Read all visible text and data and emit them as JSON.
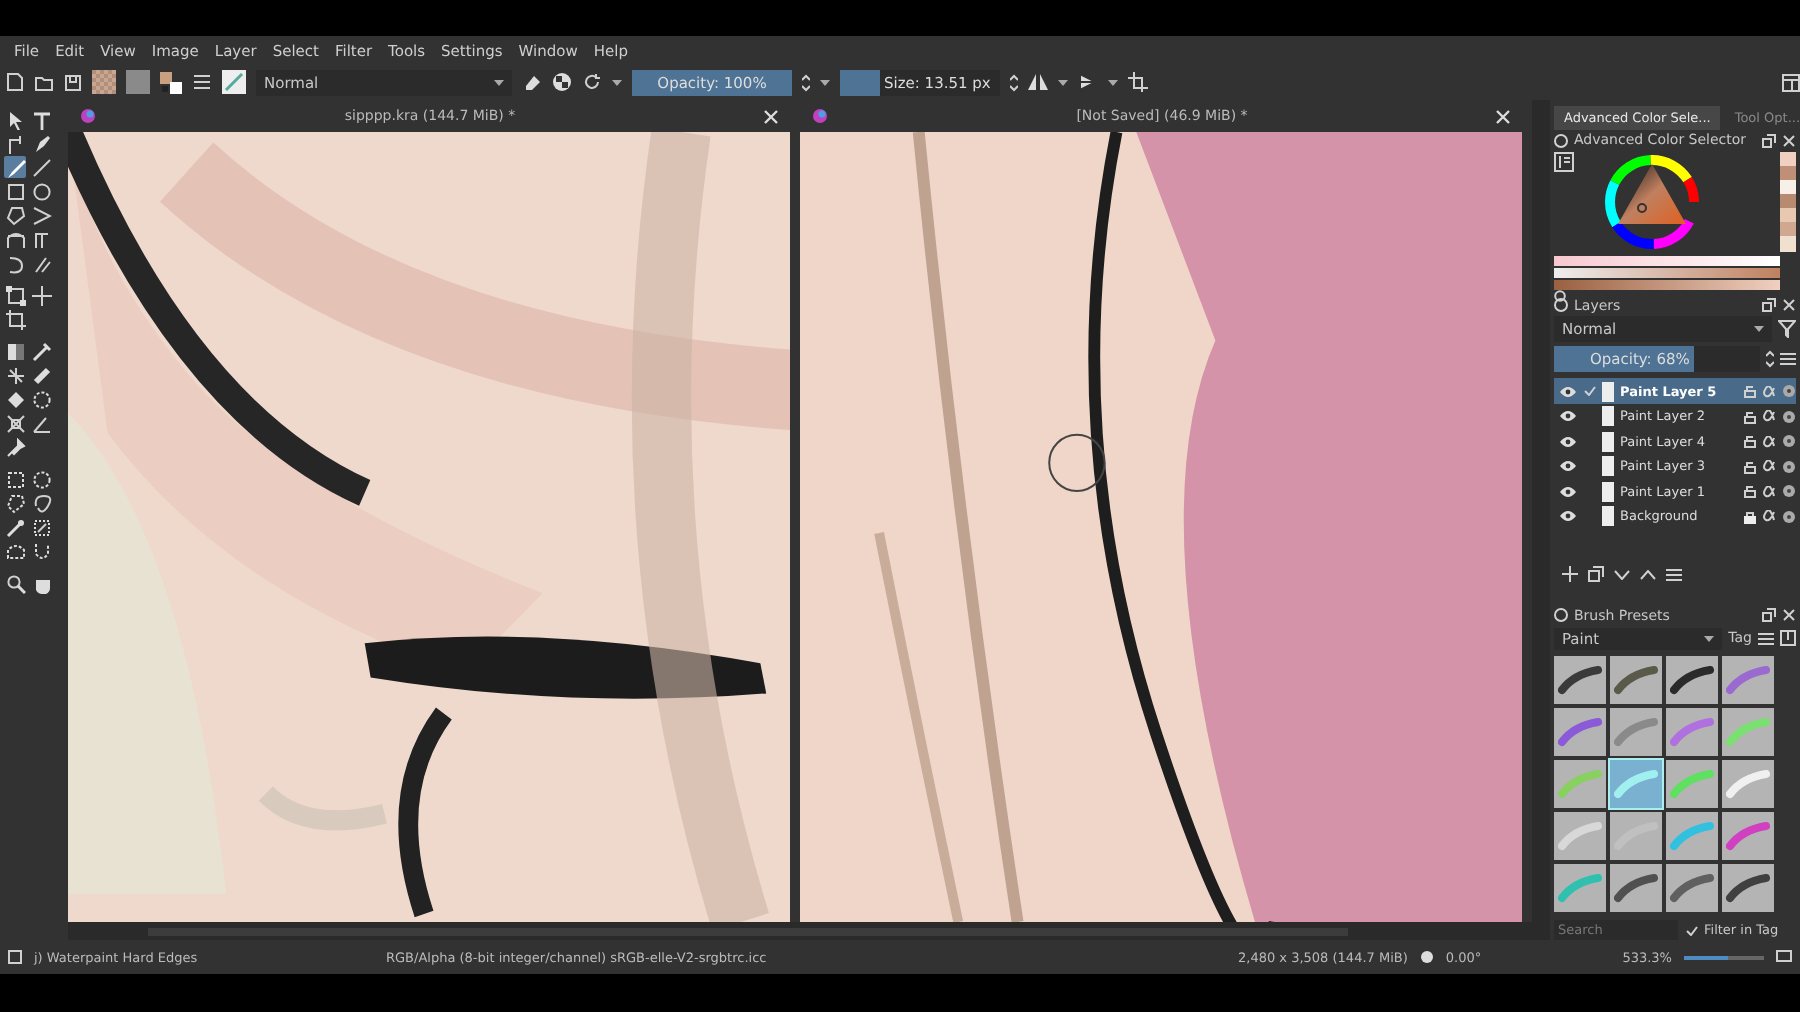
{
  "menu_bar": {
    "items": [
      "File",
      "Edit",
      "View",
      "Image",
      "Layer",
      "Select",
      "Filter",
      "Tools",
      "Settings",
      "Window",
      "Help"
    ]
  },
  "toolbar": {
    "blend_mode": "Normal",
    "opacity": {
      "label": "Opacity: 100%",
      "level": 1
    },
    "size": {
      "label": "Size: 13.51 px",
      "level": 0.25
    }
  },
  "toolbox": {
    "groups": [
      [
        {
          "kind": "select-shapes",
          "selected": false
        },
        {
          "kind": "text",
          "selected": false
        },
        {
          "kind": "edit-shapes",
          "selected": false
        },
        {
          "kind": "calligraphy",
          "selected": false
        },
        {
          "kind": "brush",
          "selected": true
        },
        {
          "kind": "line",
          "selected": false
        },
        {
          "kind": "rectangle",
          "selected": false
        },
        {
          "kind": "ellipse",
          "selected": false
        },
        {
          "kind": "polygon",
          "selected": false
        },
        {
          "kind": "polyline",
          "selected": false
        },
        {
          "kind": "bezier",
          "selected": false
        },
        {
          "kind": "freehand-path",
          "selected": false
        },
        {
          "kind": "dynamic-brush",
          "selected": false
        },
        {
          "kind": "multibrush",
          "selected": false
        }
      ],
      [
        {
          "kind": "transform",
          "selected": false
        },
        {
          "kind": "move",
          "selected": false
        },
        {
          "kind": "crop",
          "selected": false
        }
      ],
      [
        {
          "kind": "gradient",
          "selected": false
        },
        {
          "kind": "color-picker",
          "selected": false
        },
        {
          "kind": "colorize-mask",
          "selected": false
        },
        {
          "kind": "smart-patch",
          "selected": false
        },
        {
          "kind": "fill",
          "selected": false
        },
        {
          "kind": "enclose-fill",
          "selected": false
        },
        {
          "kind": "assistant",
          "selected": false
        },
        {
          "kind": "measure",
          "selected": false
        },
        {
          "kind": "reference",
          "selected": false
        }
      ],
      [
        {
          "kind": "rect-select",
          "selected": false
        },
        {
          "kind": "ellipse-select",
          "selected": false
        },
        {
          "kind": "polygon-select",
          "selected": false
        },
        {
          "kind": "freehand-select",
          "selected": false
        },
        {
          "kind": "magic-wand",
          "selected": false
        },
        {
          "kind": "similar-select",
          "selected": false
        },
        {
          "kind": "bezier-select",
          "selected": false
        },
        {
          "kind": "magnetic-select",
          "selected": false
        }
      ],
      [
        {
          "kind": "zoom",
          "selected": false
        },
        {
          "kind": "pan",
          "selected": false
        }
      ]
    ]
  },
  "views": [
    {
      "title": "sipppp.kra (144.7 MiB) *",
      "kind": "sketch"
    },
    {
      "title": "[Not Saved]  (46.9 MiB) *",
      "kind": "closeup"
    }
  ],
  "docker_tabs": [
    {
      "label": "Advanced Color Sele...",
      "selected": true
    },
    {
      "label": "Tool Opt...",
      "selected": false
    }
  ],
  "color_selector": {
    "title": "Advanced Color Selector"
  },
  "layers": {
    "title": "Layers",
    "blend_mode": "Normal",
    "opacity": {
      "label": "Opacity:  68%",
      "level": 0.68
    },
    "items": [
      {
        "name": "Paint Layer 5",
        "visible": true,
        "selected": true,
        "locked": false
      },
      {
        "name": "Paint Layer 2",
        "visible": true,
        "selected": false,
        "locked": false
      },
      {
        "name": "Paint Layer 4",
        "visible": true,
        "selected": false,
        "locked": false
      },
      {
        "name": "Paint Layer 3",
        "visible": true,
        "selected": false,
        "locked": false
      },
      {
        "name": "Paint Layer 1",
        "visible": true,
        "selected": false,
        "locked": false
      },
      {
        "name": "Background",
        "visible": true,
        "selected": false,
        "locked": true
      }
    ]
  },
  "brush_presets": {
    "title": "Brush Presets",
    "tag": "Paint",
    "tag_button": "Tag",
    "presets": [
      {
        "color": "#3a3a3a",
        "selected": false
      },
      {
        "color": "#5a5a4a",
        "selected": false
      },
      {
        "color": "#2a2a2a",
        "selected": false
      },
      {
        "color": "#9a6ad0",
        "selected": false
      },
      {
        "color": "#8a5ad8",
        "selected": false
      },
      {
        "color": "#8a8a8a",
        "selected": false
      },
      {
        "color": "#b070e0",
        "selected": false
      },
      {
        "color": "#7ae070",
        "selected": false
      },
      {
        "color": "#88d060",
        "selected": false
      },
      {
        "color": "#a0f0f0",
        "selected": true
      },
      {
        "color": "#60e060",
        "selected": false
      },
      {
        "color": "#f0f0f0",
        "selected": false
      },
      {
        "color": "#d8d8d8",
        "selected": false
      },
      {
        "color": "#c0c0c0",
        "selected": false
      },
      {
        "color": "#30c0e0",
        "selected": false
      },
      {
        "color": "#d040c0",
        "selected": false
      },
      {
        "color": "#30c0b0",
        "selected": false
      },
      {
        "color": "#505050",
        "selected": false
      },
      {
        "color": "#606060",
        "selected": false
      },
      {
        "color": "#404040",
        "selected": false
      }
    ],
    "search": {
      "placeholder": "Search"
    },
    "filter_in_tag": {
      "label": "Filter in Tag",
      "checked": true
    }
  },
  "status_bar": {
    "brush": "j) Waterpaint Hard Edges",
    "color_space": "RGB/Alpha (8-bit integer/channel)  sRGB-elle-V2-srgbtrc.icc",
    "dimensions": "2,480 x 3,508 (144.7 MiB)",
    "rotation": "0.00°",
    "zoom": "533.3%",
    "zoom_slider": {
      "level": 0.55
    }
  }
}
